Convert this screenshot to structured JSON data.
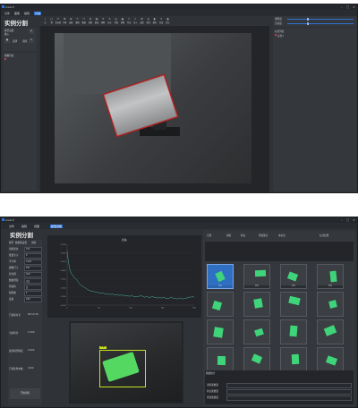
{
  "app": {
    "title": "Aisan5"
  },
  "win1": {
    "menu": [
      "文件",
      "图像",
      "编辑",
      "分割"
    ],
    "heading": "实例分割",
    "left": {
      "section1": "模型设置",
      "section1_sub": "输入",
      "btn1": "选择",
      "btn2": "清除",
      "list_label": "图像列表"
    },
    "tools": [
      "点",
      "框",
      "多边形",
      "平移",
      "缩放",
      "撤销",
      "重做",
      "复制",
      "粘贴",
      "删除",
      "标注",
      "分割",
      "查看",
      "导出",
      "导入",
      "设置",
      "类别",
      "颜色",
      "亮度",
      "对比"
    ],
    "right": {
      "label1": "透明度",
      "label2": "分割度",
      "list_title": "标签列表",
      "item1": "标签1"
    }
  },
  "win2": {
    "menu": [
      "文件",
      "编辑",
      "视图",
      "模型训练"
    ],
    "heading": "实例分割",
    "left_tabs": [
      "模型",
      "数据集设置",
      "训练"
    ],
    "params": [
      {
        "label": "训练轮次",
        "value": "100"
      },
      {
        "label": "批量大小",
        "value": "8"
      },
      {
        "label": "学习率",
        "value": "0.001"
      },
      {
        "label": "图像尺寸",
        "value": "640"
      },
      {
        "label": "优化器",
        "value": "SGD"
      },
      {
        "label": "数据增强",
        "value": "开启"
      },
      {
        "label": "预训练",
        "value": "是"
      },
      {
        "label": "线程数",
        "value": "4"
      },
      {
        "label": "设备",
        "value": "GPU"
      }
    ],
    "stats": [
      {
        "label": "已训练时长",
        "value": "00:12:34"
      },
      {
        "label": "当前轮次",
        "value": "1/100"
      },
      {
        "label": "最佳模型精度",
        "value": "0.000"
      },
      {
        "label": "已训练样本数",
        "value": "1200"
      }
    ],
    "start_button": "开始训练",
    "chart_title": "损失",
    "grid_tabs": [
      "全部",
      "训练",
      "验证",
      "测试集合",
      "未标注",
      "标注结果"
    ],
    "thumb_caption": "样本",
    "bottom_label": "数据统计",
    "bottom_rows": [
      "训练集数量",
      "验证集数量",
      "测试集数量"
    ],
    "tag_label": "Target"
  },
  "chart_data": {
    "type": "line",
    "title": "损失",
    "xlabel": "",
    "ylabel": "",
    "x": [
      0,
      2,
      4,
      6,
      8,
      10,
      12,
      14,
      16,
      18,
      20,
      22,
      24,
      26,
      28,
      30,
      32,
      35,
      38,
      41,
      44,
      47,
      50,
      53,
      56,
      59,
      62,
      65,
      68,
      71,
      74,
      77,
      80,
      83,
      86,
      89,
      92,
      95,
      98,
      101,
      104,
      107,
      110,
      113,
      116,
      119,
      122,
      125,
      128,
      131,
      134,
      137,
      140,
      143,
      146,
      149,
      152,
      155,
      158,
      161,
      164,
      167,
      170,
      173,
      176,
      179,
      182,
      185,
      188,
      191,
      194,
      197,
      200
    ],
    "y": [
      0.62,
      0.5,
      0.42,
      0.37,
      0.35,
      0.33,
      0.31,
      0.3,
      0.28,
      0.26,
      0.24,
      0.23,
      0.22,
      0.21,
      0.2,
      0.19,
      0.18,
      0.17,
      0.16,
      0.16,
      0.15,
      0.15,
      0.14,
      0.14,
      0.14,
      0.13,
      0.13,
      0.13,
      0.12,
      0.13,
      0.12,
      0.12,
      0.12,
      0.11,
      0.12,
      0.11,
      0.11,
      0.11,
      0.1,
      0.11,
      0.1,
      0.1,
      0.1,
      0.1,
      0.11,
      0.1,
      0.09,
      0.1,
      0.09,
      0.09,
      0.1,
      0.09,
      0.09,
      0.08,
      0.09,
      0.08,
      0.09,
      0.08,
      0.08,
      0.08,
      0.09,
      0.08,
      0.08,
      0.07,
      0.08,
      0.08,
      0.07,
      0.08,
      0.08,
      0.09,
      0.09,
      0.1,
      0.09
    ],
    "xlim": [
      0,
      200
    ],
    "ylim": [
      0,
      0.7
    ],
    "xticks": [
      "0",
      "50",
      "100",
      "150",
      "200"
    ],
    "yticks": [
      "0.000",
      "0.100",
      "0.200",
      "0.300",
      "0.400",
      "0.500",
      "0.600",
      "0.700"
    ]
  }
}
